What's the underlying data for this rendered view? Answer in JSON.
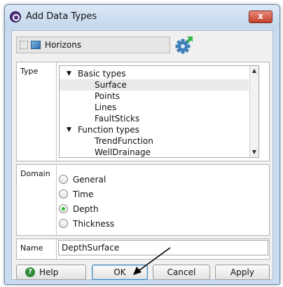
{
  "window": {
    "title": "Add Data Types",
    "close_label": "x"
  },
  "source": {
    "label": "Horizons"
  },
  "type_section": {
    "label": "Type",
    "groups": [
      {
        "label": "Basic types",
        "items": [
          "Surface",
          "Points",
          "Lines",
          "FaultSticks"
        ]
      },
      {
        "label": "Function types",
        "items": [
          "TrendFunction",
          "WellDrainage"
        ]
      }
    ],
    "selected": "Surface"
  },
  "domain_section": {
    "label": "Domain",
    "options": [
      "General",
      "Time",
      "Depth",
      "Thickness"
    ],
    "selected": "Depth",
    "selected_color": "#2fbf39"
  },
  "name_section": {
    "label": "Name",
    "value": "DepthSurface"
  },
  "buttons": {
    "help": "Help",
    "ok": "OK",
    "cancel": "Cancel",
    "apply": "Apply"
  },
  "icons": {
    "app": "app-icon",
    "source": "horizon-icon",
    "settings": "gear-icon",
    "help": "help-icon",
    "annotation": "pointer-arrow-icon"
  },
  "colors": {
    "titlebar": "#c9dcef",
    "close": "#c4412c",
    "gear": "#3f7fb8",
    "gear_accent": "#33b54a"
  }
}
